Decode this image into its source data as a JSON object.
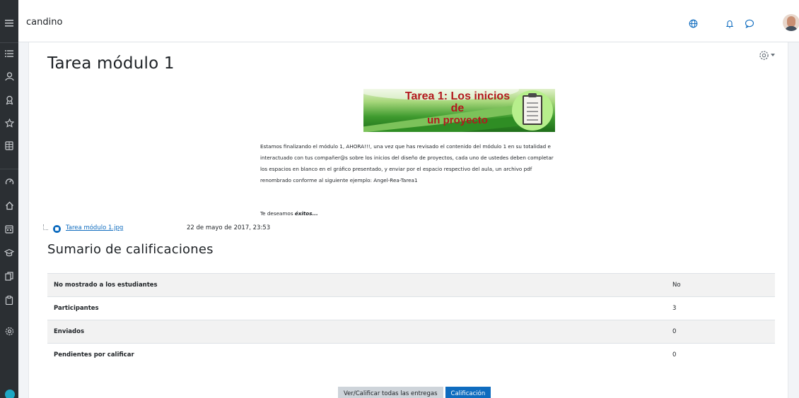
{
  "colors": {
    "brand": "#0f6cbf",
    "rail": "#2b2f33",
    "help": "#1ea7c4"
  },
  "rail": {
    "icons": [
      "menu-icon",
      "list-icon",
      "participants-icon",
      "badges-icon",
      "star-icon",
      "gradebook-icon",
      "dashboard-icon",
      "home-icon",
      "calendar-icon",
      "courses-icon",
      "files-icon",
      "clipboard-icon",
      "settings-icon"
    ]
  },
  "navbar": {
    "site_name": "candino",
    "icons": [
      "globe-icon",
      "bell-icon",
      "chat-icon"
    ]
  },
  "page": {
    "title": "Tarea módulo 1"
  },
  "banner": {
    "line1": "Tarea 1: Los inicios de",
    "line2": "un proyecto"
  },
  "description": {
    "paragraph": "Estamos finalizando el módulo 1, AHORA!!!, una vez que has revisado el contenido del módulo 1 en su totalidad e interactuado con tus compañer@s sobre los inicios del diseño de proyectos, cada uno de ustedes deben completar los espacios en blanco en el gráfico presentado, y enviar por el espacio respectivo del aula, un archivo pdf renombrado conforme al siguiente ejemplo: Angel-Rea-Tarea1",
    "wish_prefix": "Te deseamos ",
    "wish_bold": "éxitos..."
  },
  "attachment": {
    "name": "Tarea módulo 1.jpg",
    "date": "22 de mayo de 2017, 23:53"
  },
  "summary": {
    "title": "Sumario de calificaciones",
    "rows": [
      {
        "label": "No mostrado a los estudiantes",
        "value": "No"
      },
      {
        "label": "Participantes",
        "value": "3"
      },
      {
        "label": "Enviados",
        "value": "0"
      },
      {
        "label": "Pendientes por calificar",
        "value": "0"
      }
    ]
  },
  "actions": {
    "view_all": "Ver/Calificar todas las entregas",
    "grade": "Calificación"
  }
}
